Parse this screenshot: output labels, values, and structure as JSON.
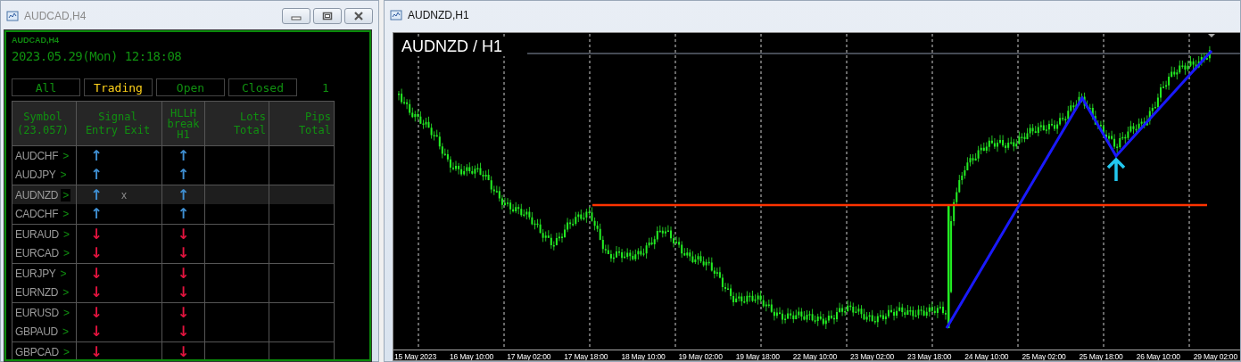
{
  "left_window": {
    "title": "AUDCAD,H4",
    "panel": {
      "caption": "AUDCAD,H4",
      "datetime": "2023.05.29(Mon) 12:18:08",
      "tabs": [
        {
          "label": "All",
          "selected": false
        },
        {
          "label": "Trading",
          "selected": true
        },
        {
          "label": "Open",
          "selected": false
        },
        {
          "label": "Closed",
          "selected": false
        }
      ],
      "count": "1",
      "columns": [
        {
          "lines": [
            "Symbol",
            "(23.057)"
          ]
        },
        {
          "lines": [
            "Signal",
            "Entry  Exit"
          ]
        },
        {
          "lines": [
            "HLLH",
            "break",
            "H1"
          ]
        },
        {
          "lines": [
            "Lots",
            "Total"
          ]
        },
        {
          "lines": [
            "Pips",
            "Total"
          ]
        }
      ],
      "rows": [
        {
          "symbol": "AUDCHF",
          "chevron": ">",
          "selected": false,
          "entry": "↑",
          "hllh": "↑",
          "color": "#3f8fd2"
        },
        {
          "symbol": "AUDJPY",
          "chevron": ">",
          "selected": false,
          "entry": "↑",
          "hllh": "↑",
          "color": "#3f8fd2"
        },
        {
          "symbol": "AUDNZD",
          "chevron": ">",
          "selected": true,
          "entry": "↑",
          "exit": "x",
          "hllh": "↑",
          "color": "#3f8fd2"
        },
        {
          "symbol": "CADCHF",
          "chevron": ">",
          "selected": false,
          "entry": "↑",
          "hllh": "↑",
          "color": "#3f8fd2"
        },
        {
          "symbol": "EURAUD",
          "chevron": ">",
          "selected": false,
          "entry": "↓",
          "hllh": "↓",
          "color": "#e3143f"
        },
        {
          "symbol": "EURCAD",
          "chevron": ">",
          "selected": false,
          "entry": "↓",
          "hllh": "↓",
          "color": "#e3143f"
        },
        {
          "symbol": "EURJPY",
          "chevron": ">",
          "selected": false,
          "entry": "↓",
          "hllh": "↓",
          "color": "#e3143f"
        },
        {
          "symbol": "EURNZD",
          "chevron": ">",
          "selected": false,
          "entry": "↓",
          "hllh": "↓",
          "color": "#e3143f"
        },
        {
          "symbol": "EURUSD",
          "chevron": ">",
          "selected": false,
          "entry": "↓",
          "hllh": "↓",
          "color": "#e3143f"
        },
        {
          "symbol": "GBPAUD",
          "chevron": ">",
          "selected": false,
          "entry": "↓",
          "hllh": "↓",
          "color": "#e3143f"
        },
        {
          "symbol": "GBPCAD",
          "chevron": ">",
          "selected": false,
          "entry": "↓",
          "hllh": "↓",
          "color": "#e3143f"
        }
      ]
    }
  },
  "right_window": {
    "title": "AUDNZD,H1",
    "chart": {
      "title": "AUDNZD / H1",
      "x_labels": [
        "15 May 2023",
        "16 May 10:00",
        "17 May 02:00",
        "17 May 18:00",
        "18 May 10:00",
        "19 May 02:00",
        "19 May 18:00",
        "22 May 10:00",
        "23 May 02:00",
        "23 May 18:00",
        "24 May 10:00",
        "25 May 02:00",
        "25 May 18:00",
        "26 May 10:00",
        "29 May 02:00"
      ]
    }
  }
}
